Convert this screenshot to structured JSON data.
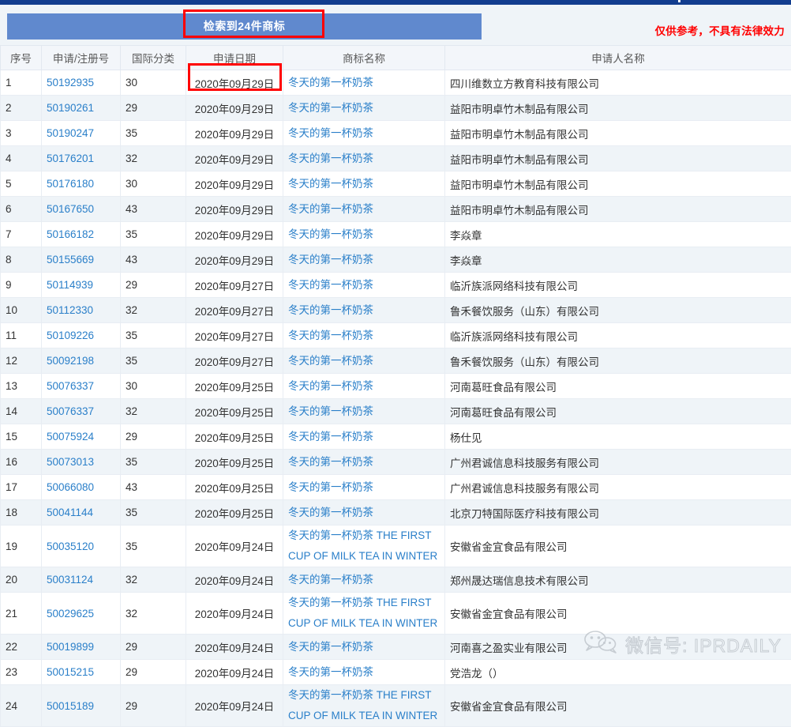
{
  "banner": {
    "count_text": "检索到24件商标",
    "legal_note": "仅供参考，不具有法律效力",
    "banner_color": "#6089ce",
    "highlight_color": "#ff0000",
    "note_color": "#ff0000"
  },
  "table": {
    "headers": {
      "seq": "序号",
      "app_no": "申请/注册号",
      "intl_class": "国际分类",
      "app_date": "申请日期",
      "tm_name": "商标名称",
      "applicant": "申请人名称"
    },
    "link_color": "#2a7fc9",
    "rows": [
      {
        "seq": "1",
        "app_no": "50192935",
        "intl_class": "30",
        "app_date": "2020年09月29日",
        "tm_name": "冬天的第一杯奶茶",
        "applicant": "四川维数立方教育科技有限公司"
      },
      {
        "seq": "2",
        "app_no": "50190261",
        "intl_class": "29",
        "app_date": "2020年09月29日",
        "tm_name": "冬天的第一杯奶茶",
        "applicant": "益阳市明卓竹木制品有限公司"
      },
      {
        "seq": "3",
        "app_no": "50190247",
        "intl_class": "35",
        "app_date": "2020年09月29日",
        "tm_name": "冬天的第一杯奶茶",
        "applicant": "益阳市明卓竹木制品有限公司"
      },
      {
        "seq": "4",
        "app_no": "50176201",
        "intl_class": "32",
        "app_date": "2020年09月29日",
        "tm_name": "冬天的第一杯奶茶",
        "applicant": "益阳市明卓竹木制品有限公司"
      },
      {
        "seq": "5",
        "app_no": "50176180",
        "intl_class": "30",
        "app_date": "2020年09月29日",
        "tm_name": "冬天的第一杯奶茶",
        "applicant": "益阳市明卓竹木制品有限公司"
      },
      {
        "seq": "6",
        "app_no": "50167650",
        "intl_class": "43",
        "app_date": "2020年09月29日",
        "tm_name": "冬天的第一杯奶茶",
        "applicant": "益阳市明卓竹木制品有限公司"
      },
      {
        "seq": "7",
        "app_no": "50166182",
        "intl_class": "35",
        "app_date": "2020年09月29日",
        "tm_name": "冬天的第一杯奶茶",
        "applicant": "李焱章"
      },
      {
        "seq": "8",
        "app_no": "50155669",
        "intl_class": "43",
        "app_date": "2020年09月29日",
        "tm_name": "冬天的第一杯奶茶",
        "applicant": "李焱章"
      },
      {
        "seq": "9",
        "app_no": "50114939",
        "intl_class": "29",
        "app_date": "2020年09月27日",
        "tm_name": "冬天的第一杯奶茶",
        "applicant": "临沂族派网络科技有限公司"
      },
      {
        "seq": "10",
        "app_no": "50112330",
        "intl_class": "32",
        "app_date": "2020年09月27日",
        "tm_name": "冬天的第一杯奶茶",
        "applicant": "鲁禾餐饮服务（山东）有限公司"
      },
      {
        "seq": "11",
        "app_no": "50109226",
        "intl_class": "35",
        "app_date": "2020年09月27日",
        "tm_name": "冬天的第一杯奶茶",
        "applicant": "临沂族派网络科技有限公司"
      },
      {
        "seq": "12",
        "app_no": "50092198",
        "intl_class": "35",
        "app_date": "2020年09月27日",
        "tm_name": "冬天的第一杯奶茶",
        "applicant": "鲁禾餐饮服务（山东）有限公司"
      },
      {
        "seq": "13",
        "app_no": "50076337",
        "intl_class": "30",
        "app_date": "2020年09月25日",
        "tm_name": "冬天的第一杯奶茶",
        "applicant": "河南葛旺食品有限公司"
      },
      {
        "seq": "14",
        "app_no": "50076337",
        "intl_class": "32",
        "app_date": "2020年09月25日",
        "tm_name": "冬天的第一杯奶茶",
        "applicant": "河南葛旺食品有限公司"
      },
      {
        "seq": "15",
        "app_no": "50075924",
        "intl_class": "29",
        "app_date": "2020年09月25日",
        "tm_name": "冬天的第一杯奶茶",
        "applicant": "杨仕见"
      },
      {
        "seq": "16",
        "app_no": "50073013",
        "intl_class": "35",
        "app_date": "2020年09月25日",
        "tm_name": "冬天的第一杯奶茶",
        "applicant": "广州君诚信息科技服务有限公司"
      },
      {
        "seq": "17",
        "app_no": "50066080",
        "intl_class": "43",
        "app_date": "2020年09月25日",
        "tm_name": "冬天的第一杯奶茶",
        "applicant": "广州君诚信息科技服务有限公司"
      },
      {
        "seq": "18",
        "app_no": "50041144",
        "intl_class": "35",
        "app_date": "2020年09月25日",
        "tm_name": "冬天的第一杯奶茶",
        "applicant": "北京刀特国际医疗科技有限公司"
      },
      {
        "seq": "19",
        "app_no": "50035120",
        "intl_class": "35",
        "app_date": "2020年09月24日",
        "tm_name": "冬天的第一杯奶茶 THE FIRST CUP OF MILK TEA IN WINTER",
        "applicant": "安徽省金宜食品有限公司",
        "tall": true
      },
      {
        "seq": "20",
        "app_no": "50031124",
        "intl_class": "32",
        "app_date": "2020年09月24日",
        "tm_name": "冬天的第一杯奶茶",
        "applicant": "郑州晟达瑞信息技术有限公司"
      },
      {
        "seq": "21",
        "app_no": "50029625",
        "intl_class": "32",
        "app_date": "2020年09月24日",
        "tm_name": "冬天的第一杯奶茶 THE FIRST CUP OF MILK TEA IN WINTER",
        "applicant": "安徽省金宜食品有限公司",
        "tall": true
      },
      {
        "seq": "22",
        "app_no": "50019899",
        "intl_class": "29",
        "app_date": "2020年09月24日",
        "tm_name": "冬天的第一杯奶茶",
        "applicant": "河南喜之盈实业有限公司"
      },
      {
        "seq": "23",
        "app_no": "50015215",
        "intl_class": "29",
        "app_date": "2020年09月24日",
        "tm_name": "冬天的第一杯奶茶",
        "applicant": "党浩龙（）"
      },
      {
        "seq": "24",
        "app_no": "50015189",
        "intl_class": "29",
        "app_date": "2020年09月24日",
        "tm_name": "冬天的第一杯奶茶 THE FIRST CUP OF MILK TEA IN WINTER",
        "applicant": "安徽省金宜食品有限公司",
        "tall": true
      }
    ]
  },
  "watermark": {
    "text": "微信号: IPRDAILY",
    "icon": "wechat-icon"
  }
}
